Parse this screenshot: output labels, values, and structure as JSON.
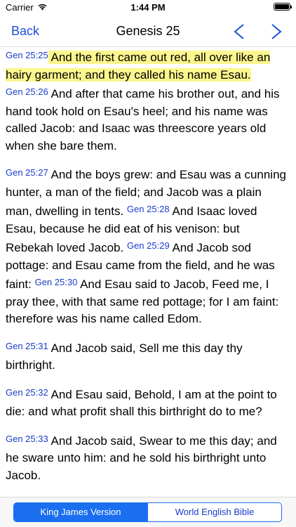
{
  "status": {
    "carrier": "Carrier",
    "time": "1:44 PM"
  },
  "nav": {
    "back_label": "Back",
    "title": "Genesis 25"
  },
  "icons": {
    "prev": "chevron-left-icon",
    "next": "chevron-right-icon",
    "wifi": "wifi-icon",
    "battery": "battery-icon"
  },
  "colors": {
    "accent": "#1a6ff0",
    "verse_ref": "#1a3cc9",
    "highlight": "#fbf68d"
  },
  "verses": [
    {
      "ref": "Gen 25:25",
      "text": " And the first came out red, all over like an hairy garment; and they called his name Esau."
    },
    {
      "ref": "Gen 25:26",
      "text": " And after that came his brother out, and his hand took hold on Esau's heel; and his name was called Jacob: and Isaac was threescore years old when she bare them."
    },
    {
      "ref": "Gen 25:27",
      "text": " And the boys grew: and Esau was a cunning hunter, a man of the field; and Jacob was a plain man, dwelling in tents. "
    },
    {
      "ref": "Gen 25:28",
      "text": " And Isaac loved Esau, because he did eat of his venison: but Rebekah loved Jacob. "
    },
    {
      "ref": "Gen 25:29",
      "text": " And Jacob sod pottage: and Esau came from the field, and he was faint: "
    },
    {
      "ref": "Gen 25:30",
      "text": " And Esau said to Jacob, Feed me, I pray thee, with that same red pottage; for I am faint: therefore was his name called Edom."
    },
    {
      "ref": "Gen 25:31",
      "text": " And Jacob said, Sell me this day thy birthright."
    },
    {
      "ref": "Gen 25:32",
      "text": " And Esau said, Behold, I am at the point to die: and what profit shall this birthright do to me?"
    },
    {
      "ref": "Gen 25:33",
      "text": " And Jacob said, Swear to me this day; and he sware unto him: and he sold his birthright unto Jacob."
    }
  ],
  "versions": {
    "selected": "King James Version",
    "other": "World English Bible"
  }
}
